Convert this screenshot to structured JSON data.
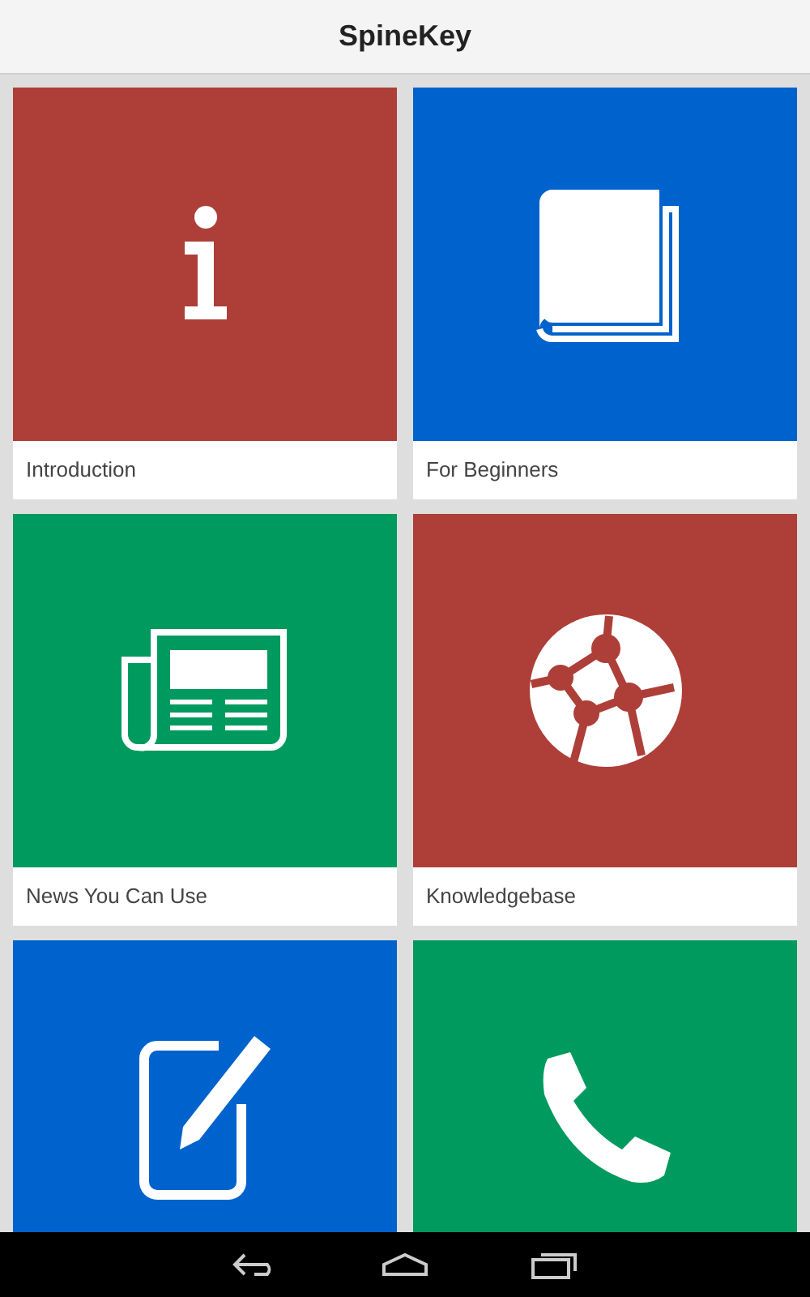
{
  "app_bar": {
    "title": "SpineKey"
  },
  "tiles": [
    {
      "label": "Introduction",
      "color": "#ad3f38"
    },
    {
      "label": "For Beginners",
      "color": "#0062cc"
    },
    {
      "label": "News You Can Use",
      "color": "#009a5e"
    },
    {
      "label": "Knowledgebase",
      "color": "#ad3f38"
    },
    {
      "color": "#0062cc"
    },
    {
      "color": "#009a5e"
    }
  ]
}
